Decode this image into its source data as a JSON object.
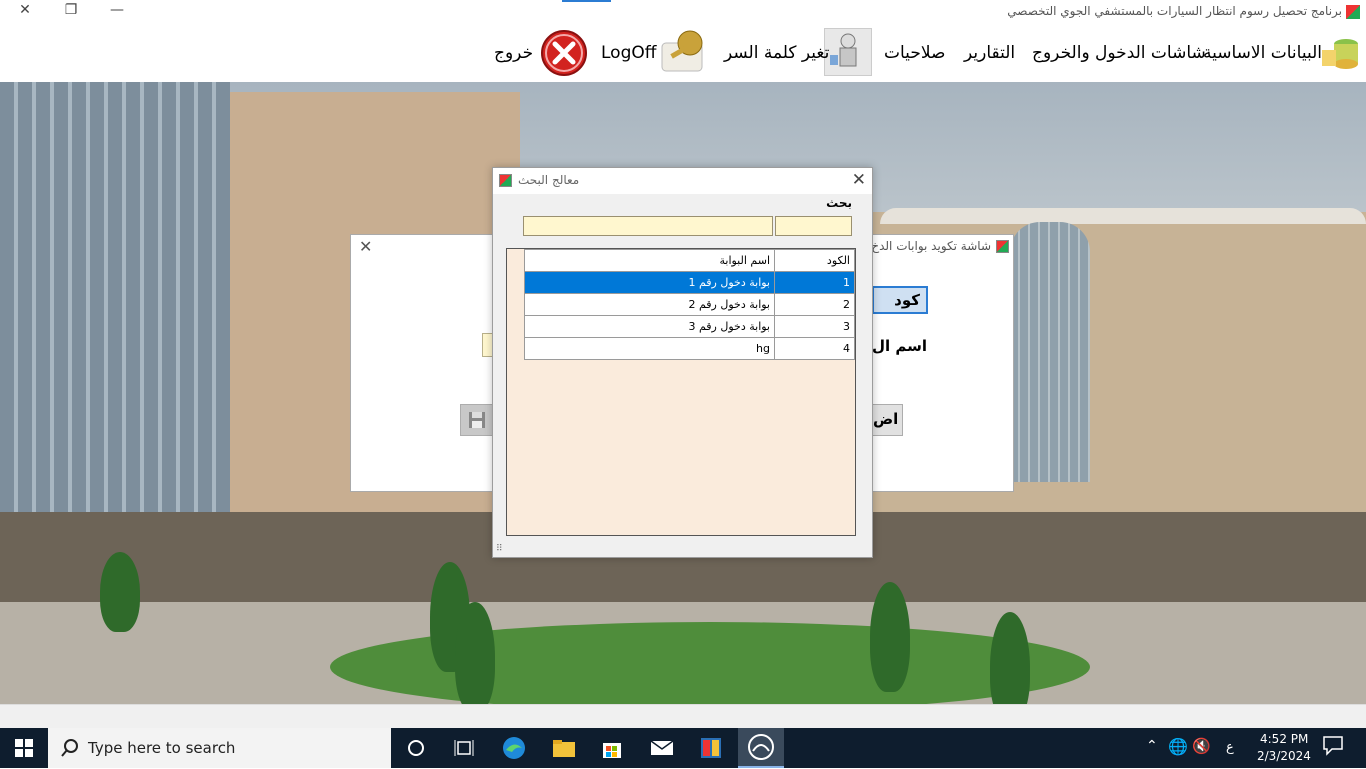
{
  "window": {
    "title": "برنامج تحصيل رسوم انتظار السيارات بالمستشفي الجوي التخصصي",
    "close_glyph": "✕",
    "restore_glyph": "❐",
    "minimize_glyph": "—"
  },
  "menu": {
    "items": [
      {
        "label": "البيانات الاساسية"
      },
      {
        "label": "شاشات الدخول والخروج"
      },
      {
        "label": "التقارير"
      },
      {
        "label": "صلاحيات"
      },
      {
        "label": "تغير كلمة السر"
      },
      {
        "label": "LogOff"
      },
      {
        "label": "خروج"
      }
    ]
  },
  "back_form": {
    "title": "شاشة تكويد بوابات الدخ",
    "code_label": "كود",
    "name_label": "اسم ال",
    "add_label": "اض"
  },
  "search_dialog": {
    "title": "معالج البحث",
    "search_label": "بحث",
    "search_value_a": "",
    "search_value_b": "",
    "grid": {
      "headers": {
        "code": "الكود",
        "name": "اسم البوابة"
      },
      "rows": [
        {
          "code": "1",
          "name": "بوابة دخول رقم 1",
          "selected": true
        },
        {
          "code": "2",
          "name": "بوابة دخول رقم 2",
          "selected": false
        },
        {
          "code": "3",
          "name": "بوابة دخول رقم 3",
          "selected": false
        },
        {
          "code": "4",
          "name": "hg",
          "selected": false
        }
      ]
    }
  },
  "taskbar": {
    "search_placeholder": "Type here to search",
    "time": "4:52 PM",
    "date": "2/3/2024",
    "ime": "ع"
  }
}
